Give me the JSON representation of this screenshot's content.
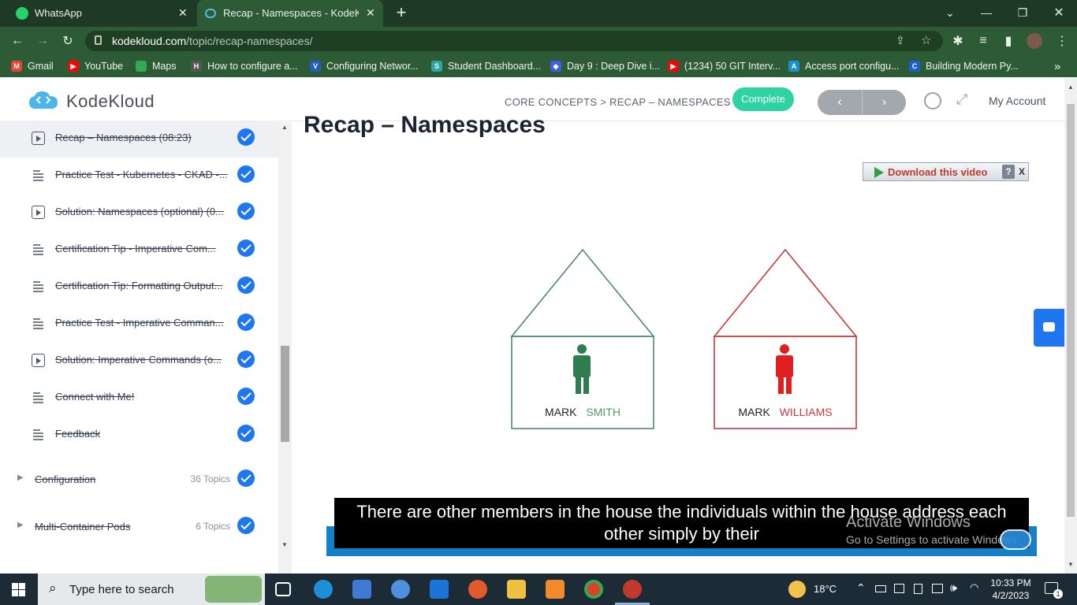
{
  "browser": {
    "tabs": [
      {
        "title": "WhatsApp",
        "icon": "whatsapp-icon",
        "color": "#25d366"
      },
      {
        "title": "Recap - Namespaces - KodeKloud",
        "icon": "kodekloud-icon",
        "color": "#3aa9e0"
      }
    ],
    "new_tab": "+",
    "url_domain": "kodekloud.com",
    "url_path": "/topic/recap-namespaces/",
    "bookmarks": [
      {
        "label": "Gmail",
        "color": "#ea4335",
        "glyph": "M"
      },
      {
        "label": "YouTube",
        "color": "#ff0000",
        "glyph": "▶"
      },
      {
        "label": "Maps",
        "color": "#34a853",
        "glyph": "⬤"
      },
      {
        "label": "How to configure a...",
        "color": "#444444",
        "glyph": "H"
      },
      {
        "label": "Configuring Networ...",
        "color": "#1f5fbf",
        "glyph": "V"
      },
      {
        "label": "Student Dashboard...",
        "color": "#2ca6a4",
        "glyph": "S"
      },
      {
        "label": "Day 9 : Deep Dive i...",
        "color": "#3e5fe0",
        "glyph": "◆"
      },
      {
        "label": "(1234) 50 GIT Interv...",
        "color": "#ff0000",
        "glyph": "▶"
      },
      {
        "label": "Access port configu...",
        "color": "#1b8fd6",
        "glyph": "A"
      },
      {
        "label": "Building Modern Py...",
        "color": "#1b5fd6",
        "glyph": "C"
      }
    ],
    "more": "»"
  },
  "header": {
    "logo": "KodeKloud",
    "breadcrumb": "CORE CONCEPTS > RECAP – NAMESPACES",
    "complete_label": "Complete",
    "prev": "‹",
    "next": "›",
    "account": "My Account"
  },
  "sidebar": {
    "lessons": [
      {
        "label": "Recap – Namespaces (08:23)",
        "type": "video",
        "active": true
      },
      {
        "label": "Practice Test - Kubernetes - CKAD -...",
        "type": "text"
      },
      {
        "label": "Solution: Namespaces (optional) (0...",
        "type": "video"
      },
      {
        "label": "Certification Tip - Imperative Com...",
        "type": "text"
      },
      {
        "label": "Certification Tip: Formatting Output...",
        "type": "text"
      },
      {
        "label": "Practice Test - Imperative Comman...",
        "type": "text"
      },
      {
        "label": "Solution: Imperative Commands (o...",
        "type": "video"
      },
      {
        "label": "Connect with Me!",
        "type": "text"
      },
      {
        "label": "Feedback",
        "type": "text"
      }
    ],
    "sections": [
      {
        "label": "Configuration",
        "count": "36 Topics"
      },
      {
        "label": "Multi-Container Pods",
        "count": "6 Topics"
      }
    ]
  },
  "main": {
    "title": "Recap – Namespaces",
    "download_label": "Download this video",
    "download_help": "?",
    "download_close": "X",
    "house_left": {
      "first": "MARK",
      "last": "SMITH",
      "color": "#4f8a6a",
      "person": "#2e7d4f"
    },
    "house_right": {
      "first": "MARK",
      "last": "WILLIAMS",
      "color": "#c83a3a",
      "person": "#e02020"
    },
    "subtitle_line1": "There are other members in the house the individuals within the house address each",
    "subtitle_line2": "other simply by their",
    "activate_title": "Activate Windows",
    "activate_sub": "Go to Settings to activate Windows."
  },
  "taskbar": {
    "search": "Type here to search",
    "weather": "18°C",
    "time": "10:33 PM",
    "date": "4/2/2023",
    "notifications": "1"
  }
}
